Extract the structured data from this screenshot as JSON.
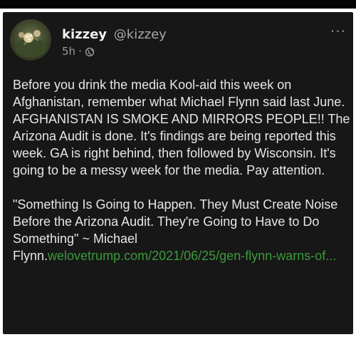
{
  "post": {
    "display_name": "kizzey",
    "handle": "@kizzey",
    "time": "5h",
    "separator": "·",
    "more_icon": "more-horizontal-icon",
    "privacy_icon": "globe-icon",
    "paragraph1": "Before you drink the media Kool-aid this week on Afghanistan, remember what Michael Flynn said last June. AFGHANISTAN IS SMOKE AND MIRRORS PEOPLE!! The Arizona Audit is done. It's findings are being reported this week. GA is right behind, then followed by Wisconsin. It's going to be a messy week for the media. Pay attention.",
    "paragraph2_text": "\"Something Is Going to Happen. They Must Create Noise Before the Arizona Audit. They're Going to Have to Do Something\" ~ Michael Flynn.",
    "paragraph2_link": "welovetrump.com/2021/06/25/gen-flynn-warns-of..."
  },
  "colors": {
    "background": "#171717",
    "text": "#e6e6e6",
    "link": "#3a9a3a",
    "muted": "#9a9a9a"
  }
}
